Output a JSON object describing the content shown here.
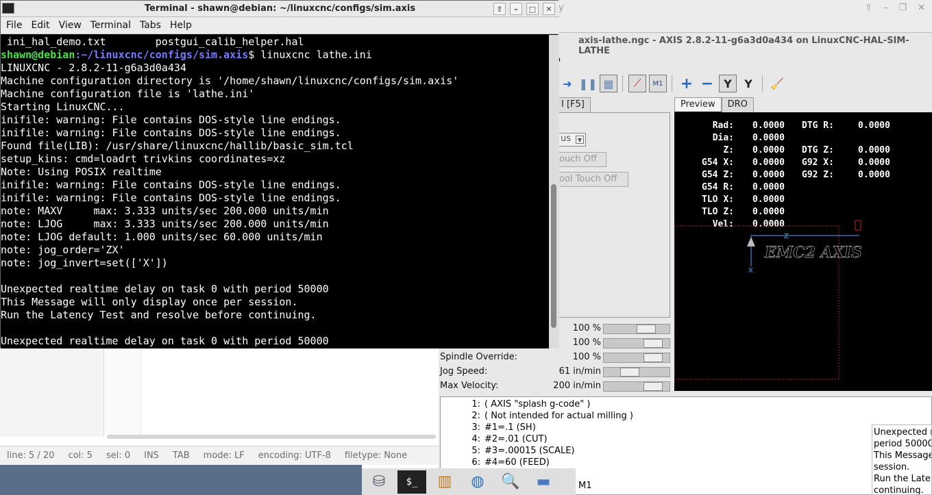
{
  "editor": {
    "status": {
      "line": "line: 5 / 20",
      "col": "col: 5",
      "sel": "sel: 0",
      "ins": "INS",
      "tab": "TAB",
      "mode": "mode: LF",
      "encoding": "encoding: UTF-8",
      "filetype": "filetype: None"
    }
  },
  "axis": {
    "title_fragment": "y",
    "name": "axis-lathe.ngc - AXIS 2.8.2-11-g6a3d0a434 on LinuxCNC-HAL-SIM-LATHE",
    "menu_fragment": "o",
    "left_tab": "I [F5]",
    "mode_select": "us",
    "touch_off": "ouch Off",
    "tool_touch_off": "ool Touch Off",
    "right_tabs": [
      "Preview",
      "DRO"
    ],
    "overrides": [
      {
        "label": "",
        "value": "100 %",
        "level": 0.7
      },
      {
        "label": "",
        "value": "100 %",
        "level": 0.85
      },
      {
        "label": "Spindle Override:",
        "value": "100 %",
        "level": 0.85
      },
      {
        "label": "Jog Speed:",
        "value": "61 in/min",
        "level": 0.35
      },
      {
        "label": "Max Velocity:",
        "value": "200 in/min",
        "level": 0.85
      }
    ],
    "dro": [
      {
        "l1": "Rad:",
        "v1": "0.0000",
        "l2": "DTG R:",
        "v2": "0.0000"
      },
      {
        "l1": "Dia:",
        "v1": "0.0000",
        "l2": "",
        "v2": ""
      },
      {
        "l1": "Z:",
        "v1": "0.0000",
        "l2": "DTG Z:",
        "v2": "0.0000"
      },
      {
        "l1": "G54 X:",
        "v1": "0.0000",
        "l2": "G92 X:",
        "v2": "0.0000"
      },
      {
        "l1": "G54 Z:",
        "v1": "0.0000",
        "l2": "G92 Z:",
        "v2": "0.0000"
      },
      {
        "l1": "G54 R:",
        "v1": "0.0000",
        "l2": "",
        "v2": ""
      },
      {
        "l1": "TLO X:",
        "v1": "0.0000",
        "l2": "",
        "v2": ""
      },
      {
        "l1": "TLO Z:",
        "v1": "0.0000",
        "l2": "",
        "v2": ""
      },
      {
        "l1": "Vel:",
        "v1": "0.0000",
        "l2": "",
        "v2": ""
      }
    ],
    "preview_text": "EMC2 AXIS",
    "preview_axis_z": "Z",
    "preview_axis_x": "X",
    "gcode": [
      {
        "n": "1:",
        "t": "( AXIS \"splash g-code\" )"
      },
      {
        "n": "2:",
        "t": "( Not intended for actual milling )"
      },
      {
        "n": "3:",
        "t": "#1=.1 (SH)"
      },
      {
        "n": "4:",
        "t": "#2=.01 (CUT)"
      },
      {
        "n": "5:",
        "t": "#3=.00015 (SCALE)"
      },
      {
        "n": "6:",
        "t": "#4=60 (FEED)"
      }
    ],
    "m1": "M1",
    "message_lines": [
      "Unexpected r",
      "period 50000",
      "This Message",
      "session.",
      "Run the Laten",
      "continuing."
    ]
  },
  "terminal": {
    "title": "Terminal - shawn@debian: ~/linuxcnc/configs/sim.axis",
    "menu": [
      "File",
      "Edit",
      "View",
      "Terminal",
      "Tabs",
      "Help"
    ],
    "prompt_user": "shawn@debian",
    "prompt_path": ":~/linuxcnc/configs/sim.axis",
    "prompt_cmd": "$ linuxcnc lathe.ini",
    "first_line": " ini_hal_demo.txt        postgui_calib_helper.hal",
    "lines": [
      "LINUXCNC - 2.8.2-11-g6a3d0a434",
      "Machine configuration directory is '/home/shawn/linuxcnc/configs/sim.axis'",
      "Machine configuration file is 'lathe.ini'",
      "Starting LinuxCNC...",
      "inifile: warning: File contains DOS-style line endings.",
      "inifile: warning: File contains DOS-style line endings.",
      "Found file(LIB): /usr/share/linuxcnc/hallib/basic_sim.tcl",
      "setup_kins: cmd=loadrt trivkins coordinates=xz",
      "Note: Using POSIX realtime",
      "inifile: warning: File contains DOS-style line endings.",
      "inifile: warning: File contains DOS-style line endings.",
      "note: MAXV     max: 3.333 units/sec 200.000 units/min",
      "note: LJOG     max: 3.333 units/sec 200.000 units/min",
      "note: LJOG default: 1.000 units/sec 60.000 units/min",
      "note: jog_order='ZX'",
      "note: jog_invert=set(['X'])",
      "",
      "Unexpected realtime delay on task 0 with period 50000",
      "This Message will only display once per session.",
      "Run the Latency Test and resolve before continuing.",
      "",
      "Unexpected realtime delay on task 0 with period 50000"
    ]
  },
  "taskbar": {
    "icons": [
      "drive-icon",
      "terminal-icon",
      "archive-icon",
      "globe-icon",
      "search-icon",
      "folder-icon"
    ]
  }
}
